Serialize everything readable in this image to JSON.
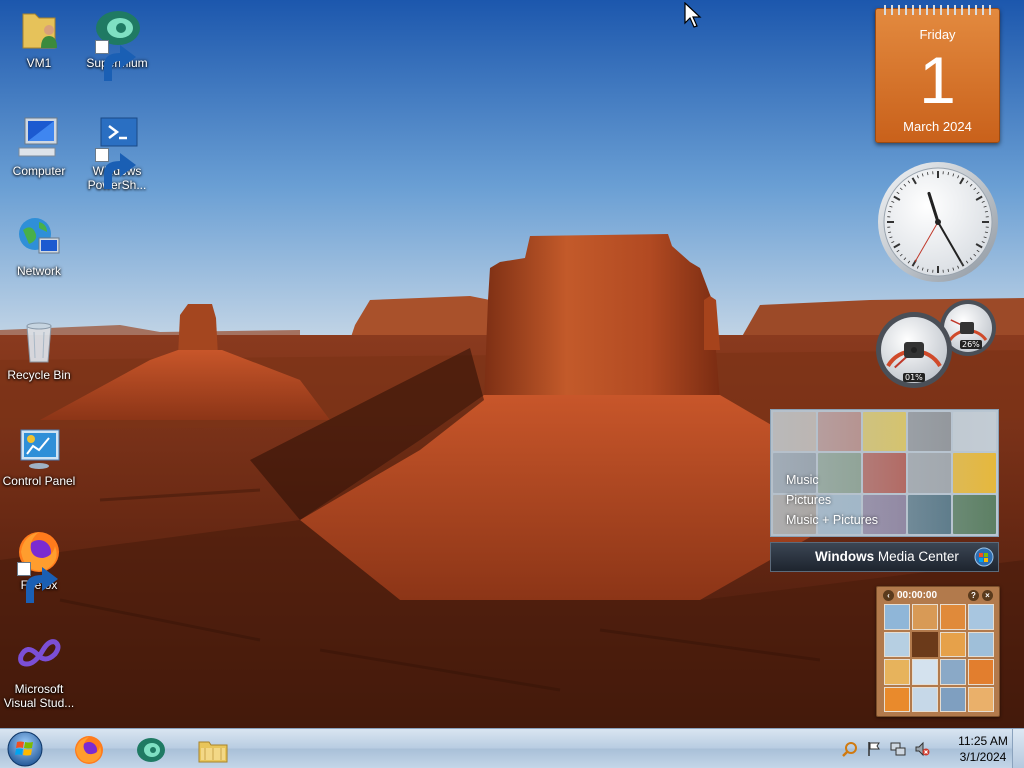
{
  "desktop": {
    "icons": [
      {
        "label": "VM1"
      },
      {
        "label": "Supermium"
      },
      {
        "label": "Computer"
      },
      {
        "label": "Windows PowerSh..."
      },
      {
        "label": "Network"
      },
      {
        "label": "Recycle Bin"
      },
      {
        "label": "Control Panel"
      },
      {
        "label": "Firefox"
      },
      {
        "label": "Microsoft Visual Stud..."
      }
    ]
  },
  "gadgets": {
    "calendar": {
      "weekday": "Friday",
      "day": "1",
      "month_year": "March 2024",
      "color": "#d9752d"
    },
    "clock": {
      "hour": 11,
      "minute": 25,
      "second": 35
    },
    "cpu_meter": {
      "cpu_label": "01%",
      "memory_label": "26%",
      "cpu_fraction": 0.01,
      "memory_fraction": 0.26
    },
    "media_center": {
      "menu": [
        "Music",
        "Pictures",
        "Music + Pictures"
      ],
      "brand_bold": "Windows",
      "brand_regular": " Media Center"
    },
    "puzzle": {
      "timer": "00:00:00",
      "help_label": "?",
      "close_label": "×"
    }
  },
  "taskbar": {
    "start_icon": "windows-orb-icon",
    "pinned": [
      {
        "name": "firefox",
        "icon": "firefox-icon"
      },
      {
        "name": "supermium",
        "icon": "supermium-icon"
      },
      {
        "name": "file-explorer",
        "icon": "folder-icon"
      }
    ],
    "tray": {
      "icons": [
        "search-icon",
        "action-center-flag-icon",
        "network-icon",
        "volume-muted-icon"
      ],
      "time": "11:25 AM",
      "date": "3/1/2024"
    }
  },
  "colors": {
    "sky_top": "#1f5fb5",
    "sky_bottom": "#a9c6e3",
    "rock": "#b5502a",
    "taskbar": "#b9cde2"
  }
}
